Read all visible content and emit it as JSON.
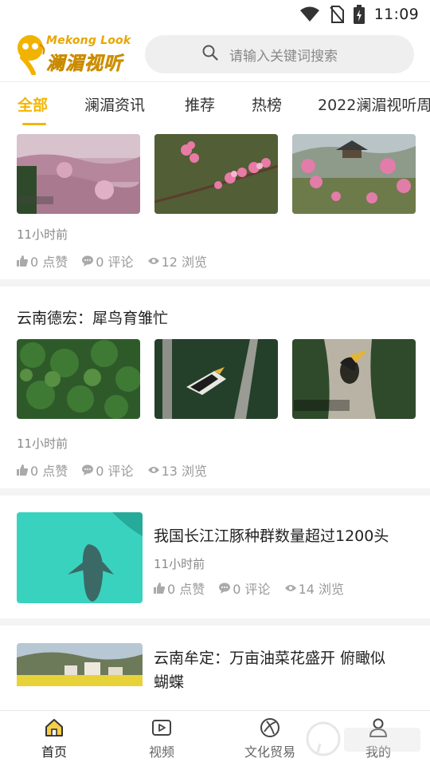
{
  "status_bar": {
    "time": "11:09",
    "icons": [
      "wifi-icon",
      "no-sim-icon",
      "battery-charging-icon"
    ]
  },
  "header": {
    "logo_en": "Mekong Look",
    "logo_cn": "澜湄视听",
    "search_placeholder": "请输入关键词搜索"
  },
  "tabs": [
    {
      "label": "全部",
      "active": true
    },
    {
      "label": "澜湄资讯",
      "active": false
    },
    {
      "label": "推荐",
      "active": false
    },
    {
      "label": "热榜",
      "active": false
    },
    {
      "label": "2022澜湄视听周",
      "active": false
    }
  ],
  "feed": [
    {
      "title": "",
      "time": "11小时前",
      "likes": "0 点赞",
      "comments": "0 评论",
      "views": "12 浏览",
      "thumbnails": [
        "peach-blossom-terraces",
        "peach-blossom-branch",
        "peach-blossom-pavilion"
      ]
    },
    {
      "title": "云南德宏：犀鸟育雏忙",
      "time": "11小时前",
      "likes": "0 点赞",
      "comments": "0 评论",
      "views": "13 浏览",
      "thumbnails": [
        "forest-aerial",
        "hornbill-flying",
        "hornbill-nest"
      ]
    },
    {
      "title": "我国长江江豚种群数量超过1200头",
      "time": "11小时前",
      "likes": "0 点赞",
      "comments": "0 评论",
      "views": "14 浏览",
      "thumbnails": [
        "finless-porpoise-underwater"
      ]
    },
    {
      "title_line1": "云南牟定：万亩油菜花盛开 俯瞰似",
      "title_line2": "蝴蝶",
      "thumbnails": [
        "rapeseed-village"
      ]
    }
  ],
  "bottom_nav": [
    {
      "label": "首页",
      "icon": "home-icon",
      "active": true
    },
    {
      "label": "视频",
      "icon": "video-icon",
      "active": false
    },
    {
      "label": "文化贸易",
      "icon": "globe-icon",
      "active": false
    },
    {
      "label": "我的",
      "icon": "user-icon",
      "active": false
    }
  ],
  "colors": {
    "accent": "#f2b600",
    "text": "#222222",
    "muted": "#888888"
  }
}
